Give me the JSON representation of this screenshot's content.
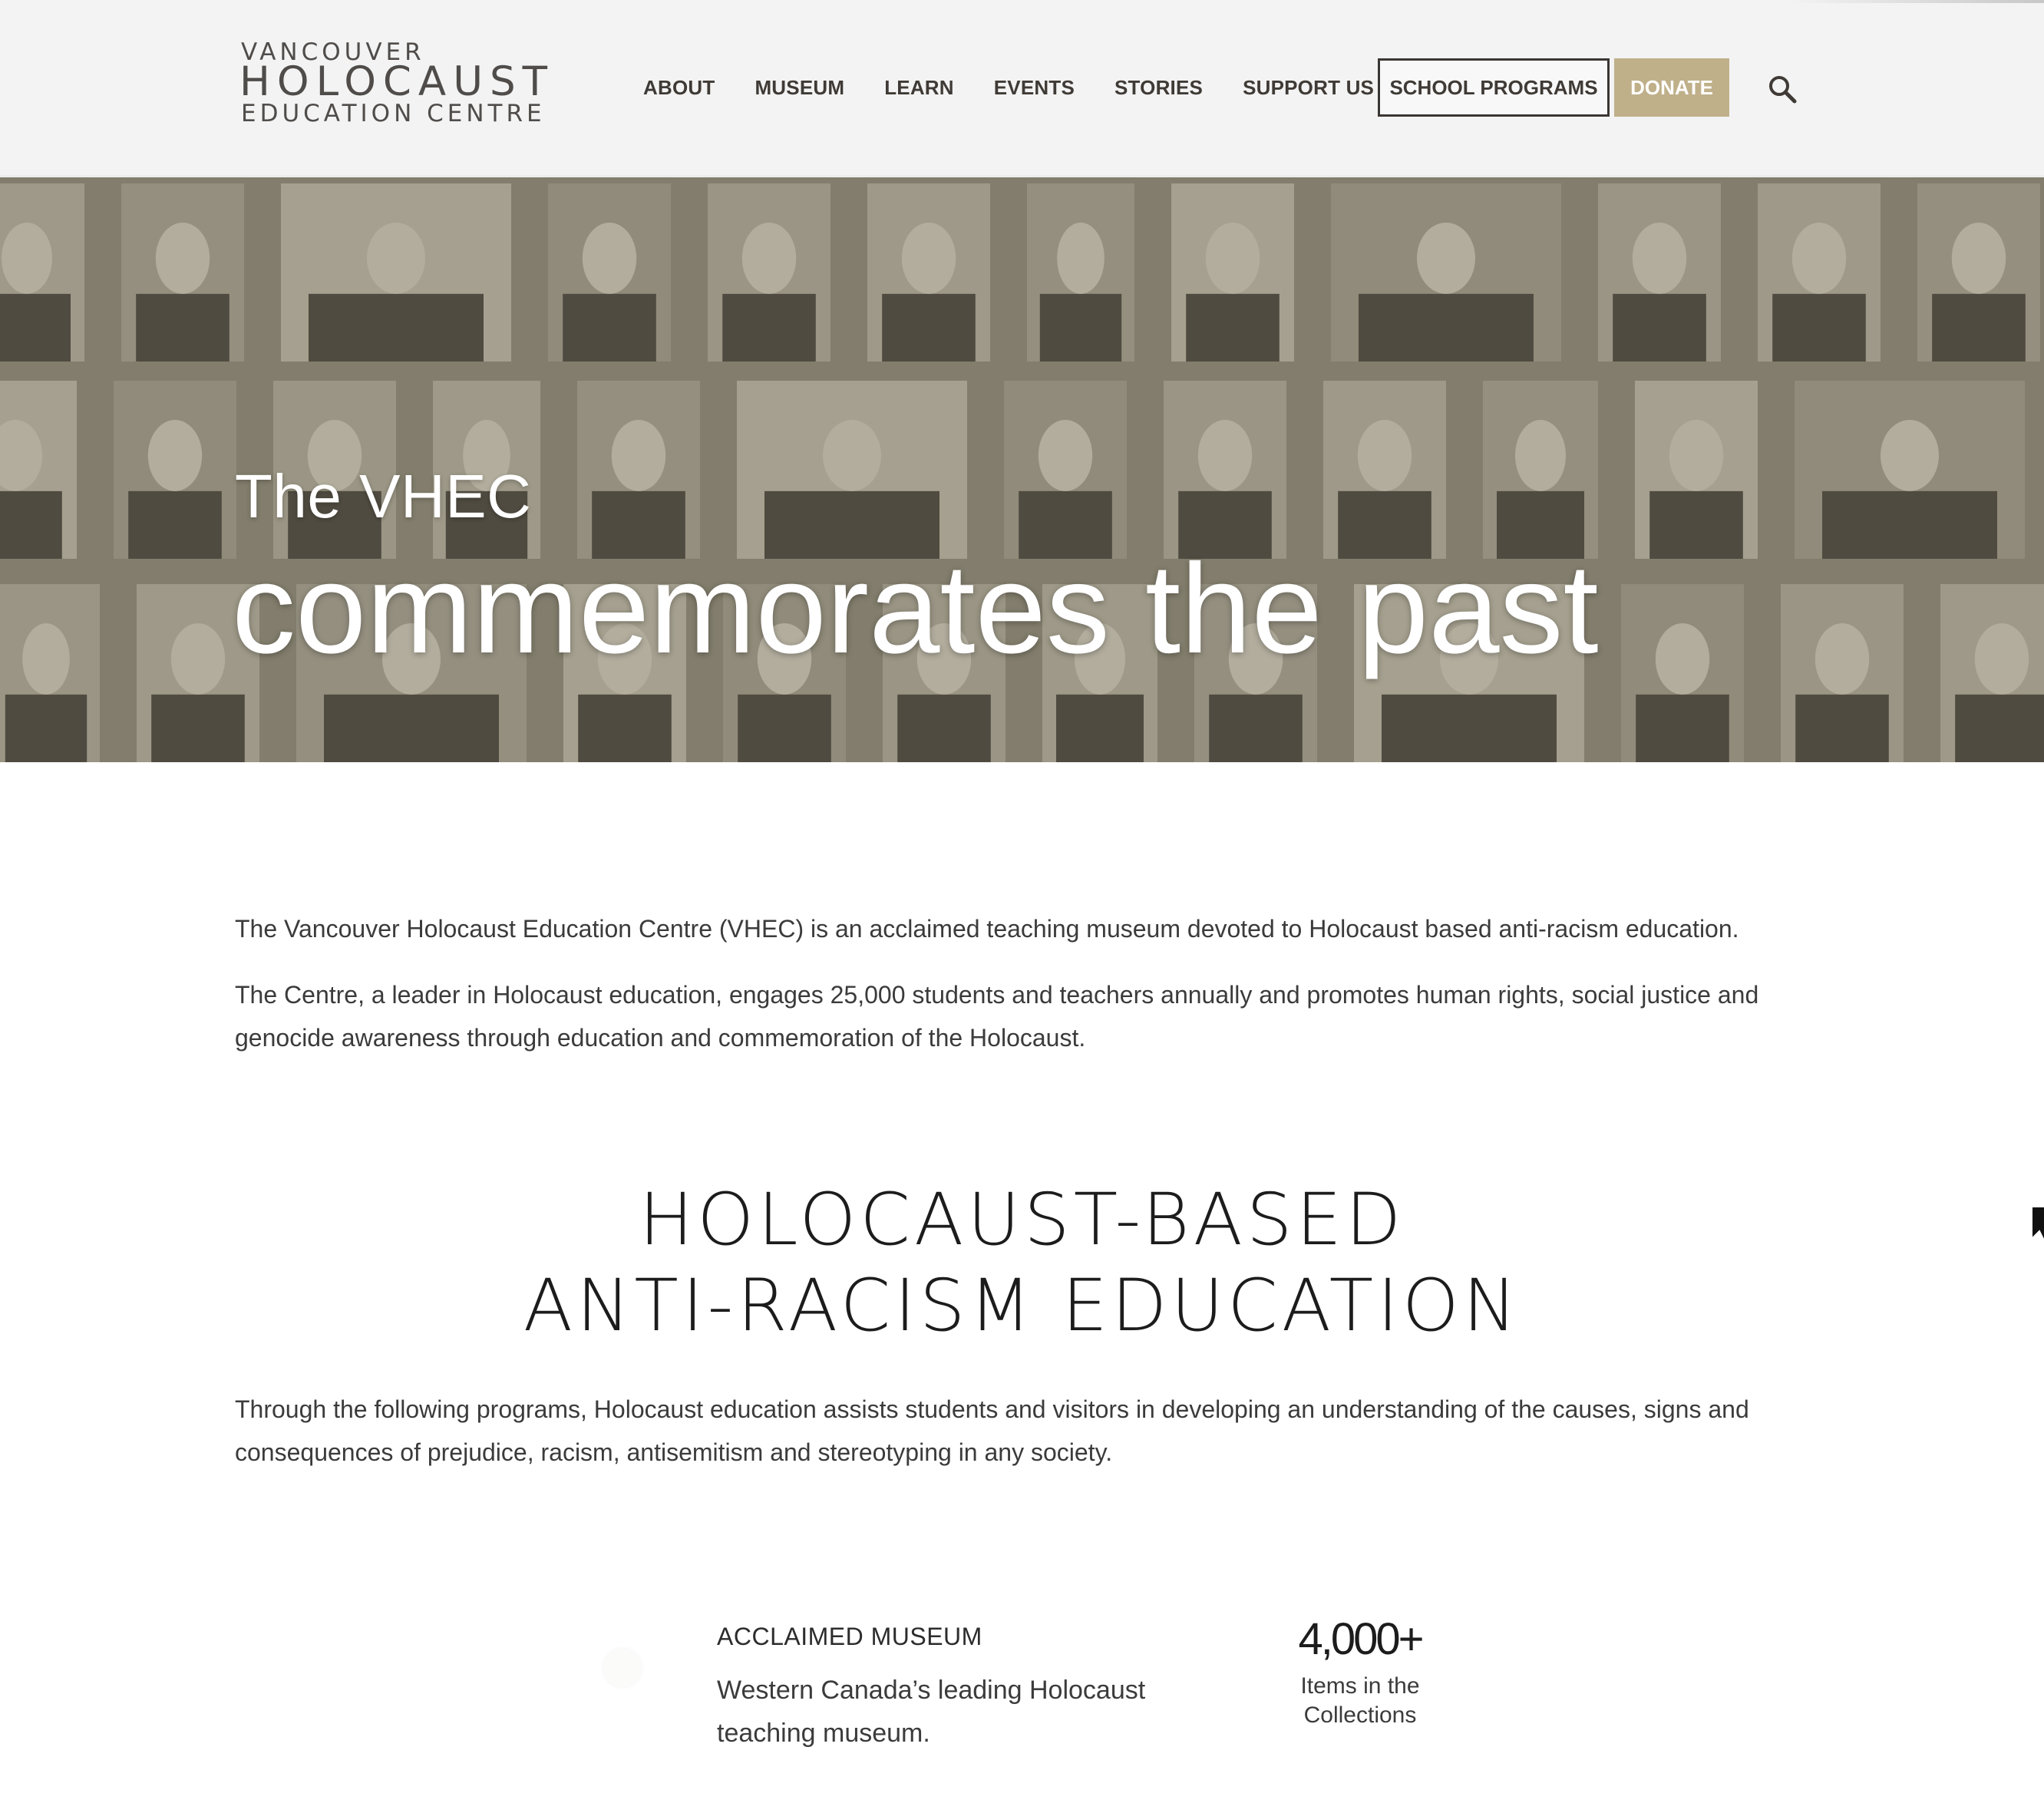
{
  "logo": {
    "line1": "VANCOUVER",
    "line2": "HOLOCAUST",
    "line3": "EDUCATION CENTRE"
  },
  "nav": {
    "items": [
      "ABOUT",
      "MUSEUM",
      "LEARN",
      "EVENTS",
      "STORIES",
      "SUPPORT US"
    ],
    "school_programs": "SCHOOL PROGRAMS",
    "donate": "DONATE",
    "search_icon": "search-icon"
  },
  "hero": {
    "subtitle": "The VHEC",
    "title": "commemorates the past"
  },
  "intro": {
    "p1": "The Vancouver Holocaust Education Centre (VHEC) is an acclaimed teaching museum devoted to Holocaust based anti-racism education.",
    "p2": "The Centre, a leader in Holocaust education, engages 25,000 students and teachers annually and promotes human rights, social justice and genocide awareness through education and commemoration of the Holocaust."
  },
  "section": {
    "title_line1": "HOLOCAUST-BASED",
    "title_line2": "ANTI-RACISM EDUCATION",
    "text": "Through the following programs, Holocaust education assists students and visitors in developing an understanding of the causes, signs and consequences of prejudice, racism, antisemitism and stereotyping in any society."
  },
  "feature": {
    "title": "ACCLAIMED MUSEUM",
    "text": "Western Canada’s leading Holocaust teaching museum."
  },
  "stat": {
    "number": "4,000+",
    "label": "Items in the Collections"
  },
  "colors": {
    "header_bg": "#f3f3f3",
    "donate_bg": "#bfb08a",
    "hero_tint": "#8a8575",
    "text": "#3b3b3b"
  }
}
